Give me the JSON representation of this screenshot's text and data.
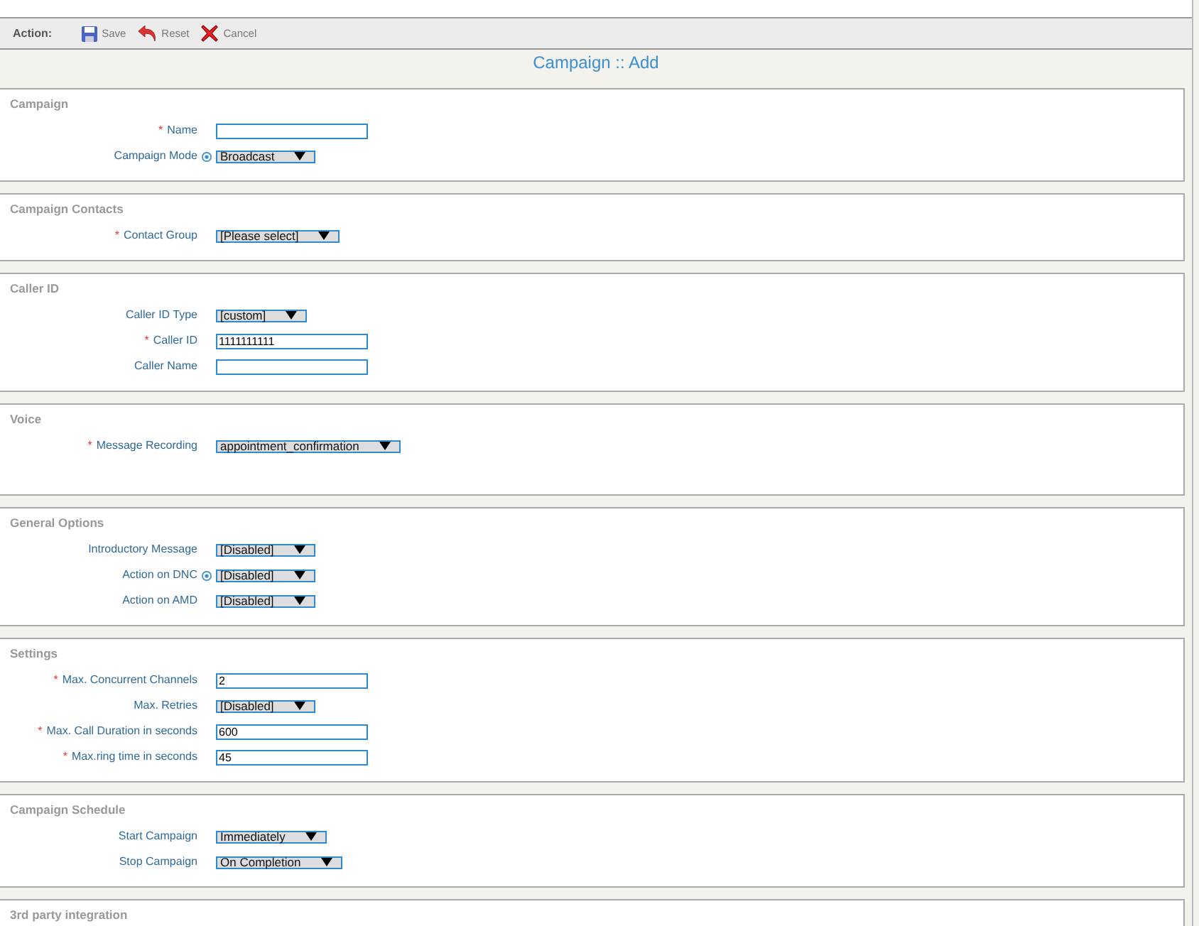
{
  "toolbar": {
    "label": "Action:",
    "buttons": [
      {
        "kind": "save",
        "label": "Save"
      },
      {
        "kind": "reset",
        "label": "Reset"
      },
      {
        "kind": "cancel",
        "label": "Cancel"
      }
    ]
  },
  "page_title": "Campaign :: Add",
  "sections": [
    {
      "title": "Campaign",
      "fields": [
        {
          "label": "Name",
          "required_mark": "*",
          "help": false,
          "kind": "input"
        },
        {
          "label": "Campaign Mode",
          "help": true,
          "kind": "select",
          "value": "Broadcast"
        }
      ]
    },
    {
      "title": "Campaign Contacts",
      "fields": [
        {
          "label": "Contact Group",
          "required_mark": "*",
          "help": false,
          "kind": "select",
          "value": "[Please select]"
        }
      ]
    },
    {
      "title": "Caller ID",
      "fields": [
        {
          "label": "Caller ID Type",
          "help": false,
          "kind": "select",
          "value": "[custom]"
        },
        {
          "label": "Caller ID",
          "required_mark": "*",
          "help": false,
          "kind": "input",
          "value": "1111111111"
        },
        {
          "label": "Caller Name",
          "help": false,
          "kind": "input"
        }
      ]
    },
    {
      "title": "Voice",
      "fields": [
        {
          "label": "Message Recording",
          "required_mark": "*",
          "help": false,
          "kind": "select",
          "value": "appointment_confirmation"
        }
      ]
    },
    {
      "title": "General Options",
      "fields": [
        {
          "label": "Introductory Message",
          "help": false,
          "kind": "select",
          "value": "[Disabled]"
        },
        {
          "label": "Action on DNC",
          "help": true,
          "kind": "select",
          "value": "[Disabled]"
        },
        {
          "label": "Action on AMD",
          "help": false,
          "kind": "select",
          "value": "[Disabled]"
        }
      ]
    },
    {
      "title": "Settings",
      "fields": [
        {
          "label": "Max. Concurrent Channels",
          "required_mark": "*",
          "help": false,
          "kind": "input",
          "value": "2"
        },
        {
          "label": "Max. Retries",
          "help": false,
          "kind": "select",
          "value": "[Disabled]"
        },
        {
          "label": "Max. Call Duration in seconds",
          "required_mark": "*",
          "help": false,
          "kind": "input",
          "value": "600"
        },
        {
          "label": "Max.ring time in seconds",
          "required_mark": "*",
          "help": false,
          "kind": "input",
          "value": "45"
        }
      ]
    },
    {
      "title": "Campaign Schedule",
      "fields": [
        {
          "label": "Start Campaign",
          "help": false,
          "kind": "select",
          "value": "Immediately"
        },
        {
          "label": "Stop Campaign",
          "help": false,
          "kind": "select",
          "value": "On Completion"
        }
      ]
    },
    {
      "title": "3rd party integration"
    }
  ]
}
